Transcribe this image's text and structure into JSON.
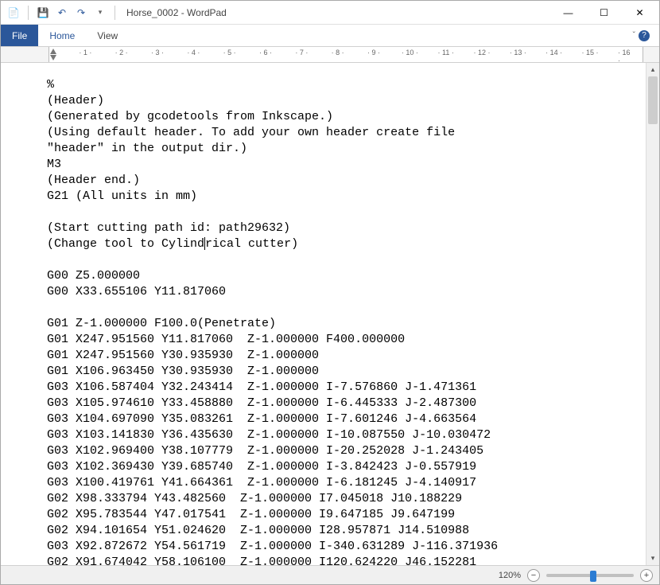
{
  "app": {
    "title": "Horse_0002 - WordPad"
  },
  "tabs": {
    "file": "File",
    "home": "Home",
    "view": "View"
  },
  "ruler": {
    "labels": [
      "1",
      "2",
      "3",
      "4",
      "5",
      "6",
      "7",
      "8",
      "9",
      "10",
      "11",
      "12",
      "13",
      "14",
      "15",
      "16"
    ]
  },
  "document": {
    "lines": [
      "%",
      "(Header)",
      "(Generated by gcodetools from Inkscape.)",
      "(Using default header. To add your own header create file",
      "\"header\" in the output dir.)",
      "M3",
      "(Header end.)",
      "G21 (All units in mm)",
      "",
      "(Start cutting path id: path29632)",
      "(Change tool to Cylindrical cutter)",
      "",
      "G00 Z5.000000",
      "G00 X33.655106 Y11.817060",
      "",
      "G01 Z-1.000000 F100.0(Penetrate)",
      "G01 X247.951560 Y11.817060  Z-1.000000 F400.000000",
      "G01 X247.951560 Y30.935930  Z-1.000000",
      "G01 X106.963450 Y30.935930  Z-1.000000",
      "G03 X106.587404 Y32.243414  Z-1.000000 I-7.576860 J-1.471361",
      "G03 X105.974610 Y33.458880  Z-1.000000 I-6.445333 J-2.487300",
      "G03 X104.697090 Y35.083261  Z-1.000000 I-7.601246 J-4.663564",
      "G03 X103.141830 Y36.435630  Z-1.000000 I-10.087550 J-10.030472",
      "G03 X102.969400 Y38.107779  Z-1.000000 I-20.252028 J-1.243405",
      "G03 X102.369430 Y39.685740  Z-1.000000 I-3.842423 J-0.557919",
      "G03 X100.419761 Y41.664361  Z-1.000000 I-6.181245 J-4.140917",
      "G02 X98.333794 Y43.482560  Z-1.000000 I7.045018 J10.188229",
      "G02 X95.783544 Y47.017541  Z-1.000000 I9.647185 J9.647199",
      "G02 X94.101654 Y51.024620  Z-1.000000 I28.957871 J14.510988",
      "G03 X92.872672 Y54.561719  Z-1.000000 I-340.631289 J-116.371936",
      "G02 X91.674042 Y58.106100  Z-1.000000 I120.624220 J46.152281"
    ],
    "cursor_line": 10,
    "cursor_col": 22
  },
  "status": {
    "zoom": "120%"
  },
  "icons": {
    "app": "📄",
    "save": "💾",
    "undo": "↶",
    "redo": "↷",
    "dropdown": "▾",
    "minimize": "—",
    "maximize": "☐",
    "close": "✕",
    "help": "?",
    "up": "▴",
    "down": "▾",
    "minus": "−",
    "plus": "+"
  }
}
